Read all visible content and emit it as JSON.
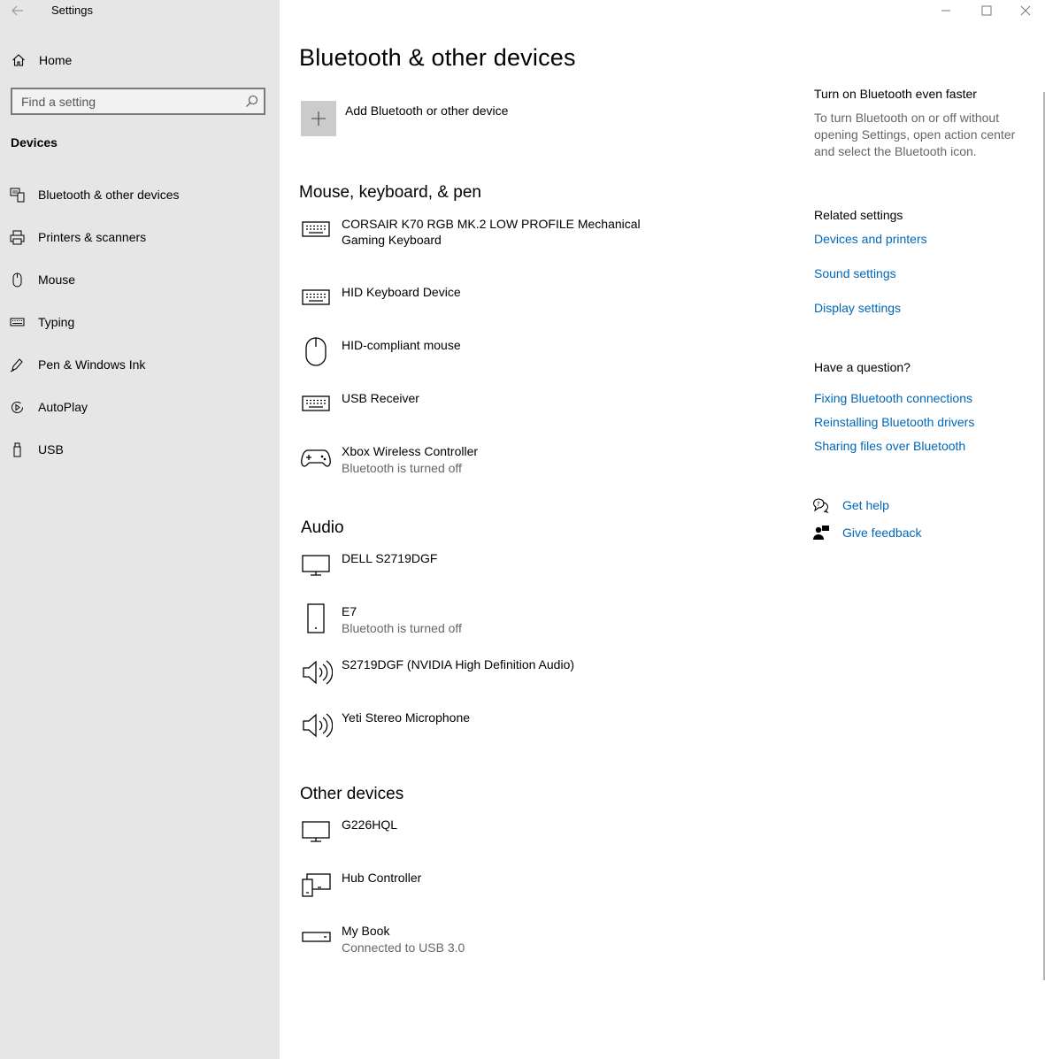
{
  "window": {
    "app_title": "Settings"
  },
  "sidebar": {
    "home_label": "Home",
    "search_placeholder": "Find a setting",
    "section_title": "Devices",
    "items": [
      {
        "label": "Bluetooth & other devices",
        "icon": "bluetooth-devices-icon"
      },
      {
        "label": "Printers & scanners",
        "icon": "printer-icon"
      },
      {
        "label": "Mouse",
        "icon": "mouse-icon"
      },
      {
        "label": "Typing",
        "icon": "keyboard-icon"
      },
      {
        "label": "Pen & Windows Ink",
        "icon": "pen-icon"
      },
      {
        "label": "AutoPlay",
        "icon": "autoplay-icon"
      },
      {
        "label": "USB",
        "icon": "usb-icon"
      }
    ]
  },
  "main": {
    "page_title": "Bluetooth & other devices",
    "add_device_label": "Add Bluetooth or other device",
    "groups": [
      {
        "title": "Mouse, keyboard, & pen",
        "devices": [
          {
            "name": "CORSAIR K70 RGB MK.2 LOW PROFILE Mechanical Gaming Keyboard",
            "status": "",
            "icon": "keyboard-icon"
          },
          {
            "name": "HID Keyboard Device",
            "status": "",
            "icon": "keyboard-icon"
          },
          {
            "name": "HID-compliant mouse",
            "status": "",
            "icon": "mouse-icon"
          },
          {
            "name": "USB Receiver",
            "status": "",
            "icon": "keyboard-icon"
          },
          {
            "name": "Xbox Wireless Controller",
            "status": "Bluetooth is turned off",
            "icon": "gamepad-icon"
          }
        ]
      },
      {
        "title": "Audio",
        "devices": [
          {
            "name": "DELL S2719DGF",
            "status": "",
            "icon": "monitor-icon"
          },
          {
            "name": "E7",
            "status": "Bluetooth is turned off",
            "icon": "phone-icon"
          },
          {
            "name": "S2719DGF (NVIDIA High Definition Audio)",
            "status": "",
            "icon": "speaker-icon"
          },
          {
            "name": "Yeti Stereo Microphone",
            "status": "",
            "icon": "speaker-icon"
          }
        ]
      },
      {
        "title": "Other devices",
        "devices": [
          {
            "name": "G226HQL",
            "status": "",
            "icon": "monitor-icon"
          },
          {
            "name": "Hub Controller",
            "status": "",
            "icon": "devices-icon"
          },
          {
            "name": "My Book",
            "status": "Connected to USB 3.0",
            "icon": "drive-icon"
          }
        ]
      }
    ]
  },
  "right": {
    "tip_title": "Turn on Bluetooth even faster",
    "tip_text": "To turn Bluetooth on or off without opening Settings, open action center and select the Bluetooth icon.",
    "related_title": "Related settings",
    "related_links": [
      "Devices and printers",
      "Sound settings",
      "Display settings"
    ],
    "question_title": "Have a question?",
    "question_links": [
      "Fixing Bluetooth connections",
      "Reinstalling Bluetooth drivers",
      "Sharing files over Bluetooth"
    ],
    "get_help": "Get help",
    "give_feedback": "Give feedback"
  },
  "colors": {
    "sidebar_bg": "#e6e6e6",
    "link": "#0067b8",
    "secondary_text": "#666666"
  }
}
